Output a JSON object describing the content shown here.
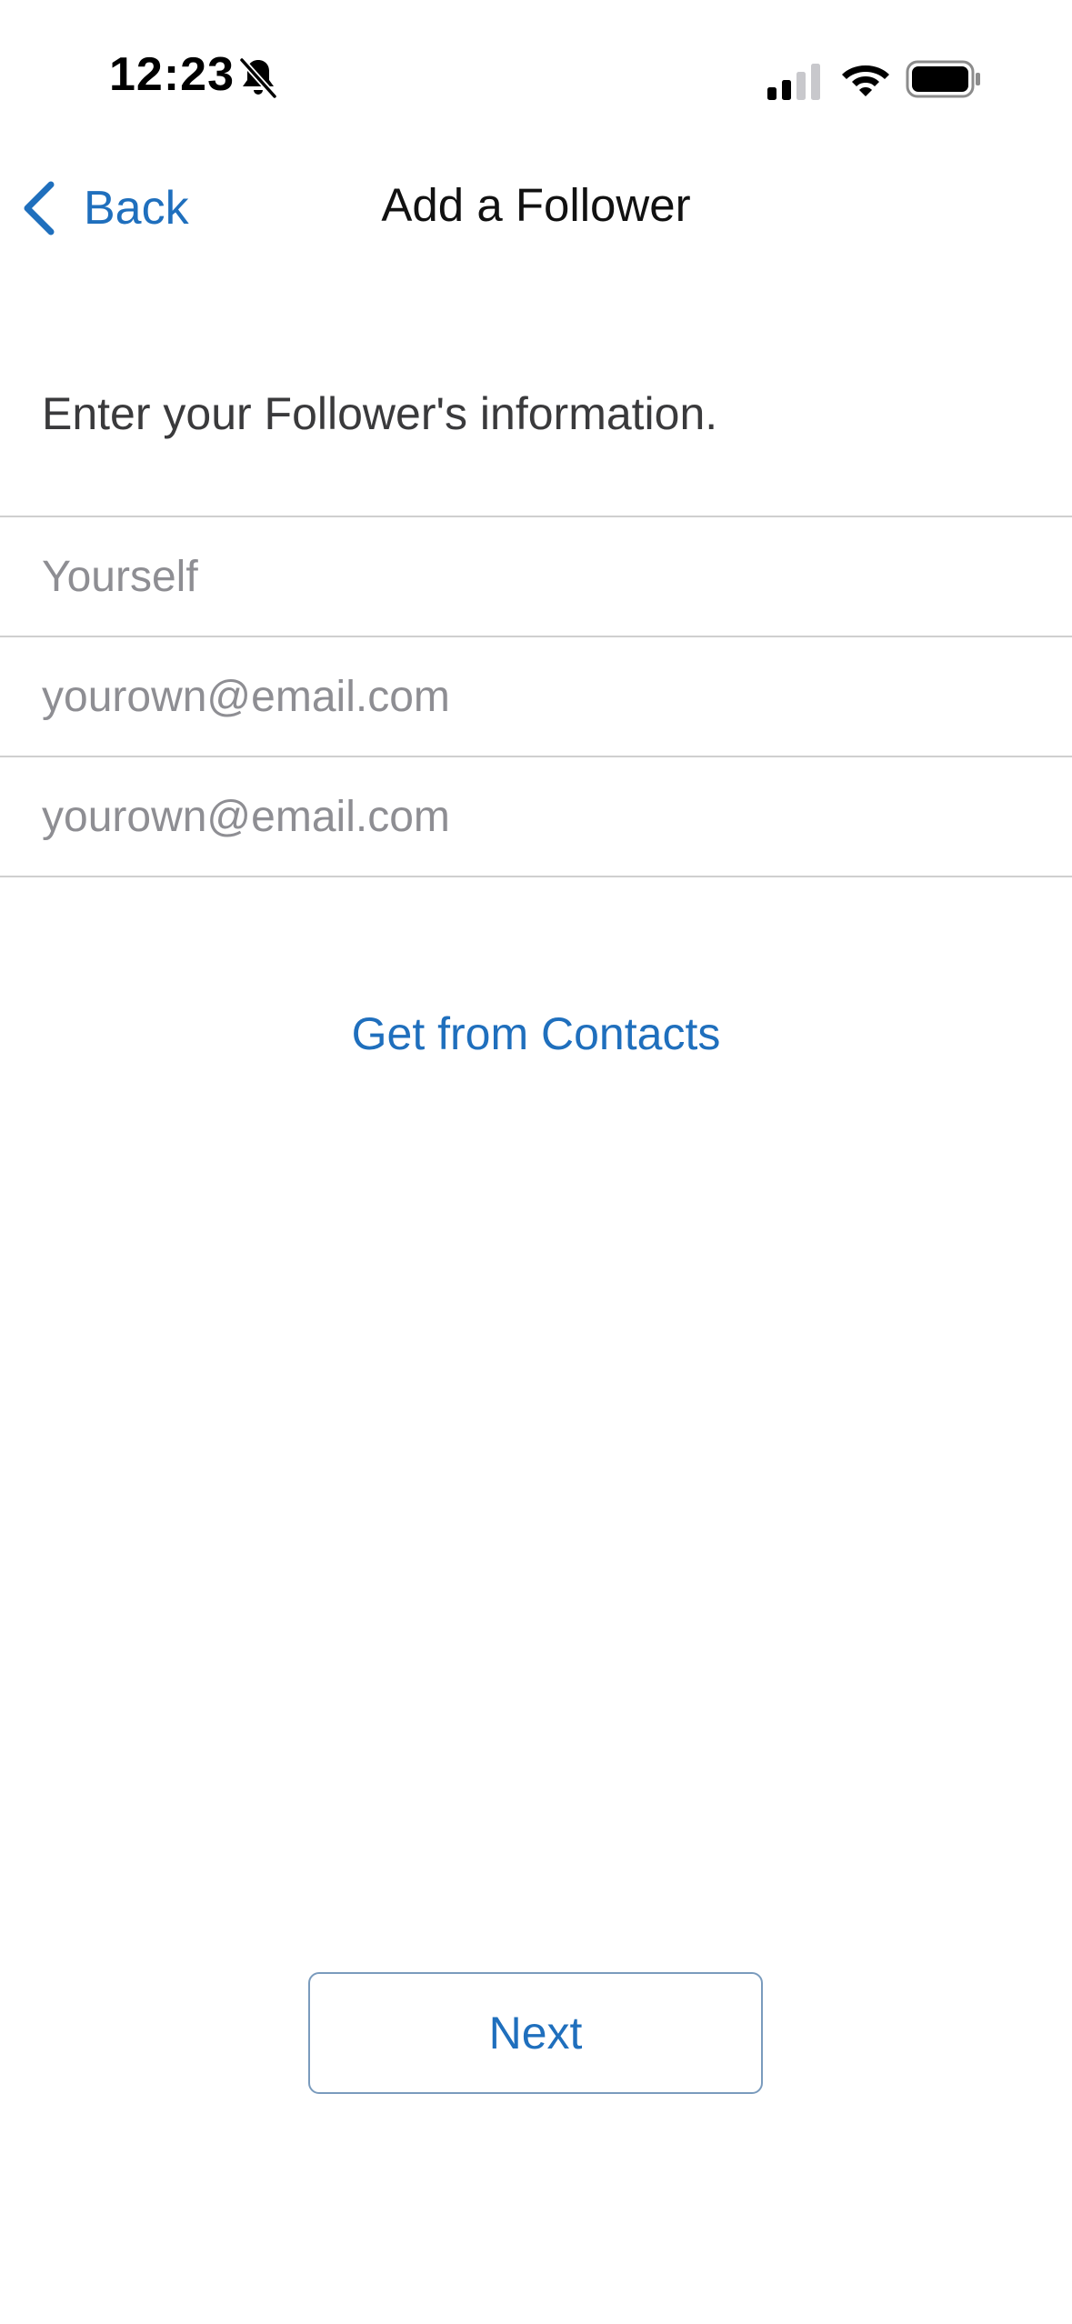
{
  "status_bar": {
    "time": "12:23",
    "icons": [
      "bell-slash-icon",
      "cellular-signal-icon",
      "wifi-icon",
      "battery-icon"
    ]
  },
  "nav": {
    "back_label": "Back",
    "title": "Add a Follower"
  },
  "form": {
    "instructions": "Enter your Follower's information.",
    "fields": [
      {
        "name": "name",
        "value": "",
        "placeholder": "Yourself"
      },
      {
        "name": "email",
        "value": "",
        "placeholder": "yourown@email.com"
      },
      {
        "name": "confirm-email",
        "value": "",
        "placeholder": "yourown@email.com"
      }
    ]
  },
  "actions": {
    "contacts_label": "Get from Contacts",
    "next_label": "Next"
  },
  "colors": {
    "accent": "#1f6fbd",
    "divider": "#cfcfcf",
    "placeholder": "#8e8e93",
    "background": "#ffffff"
  }
}
